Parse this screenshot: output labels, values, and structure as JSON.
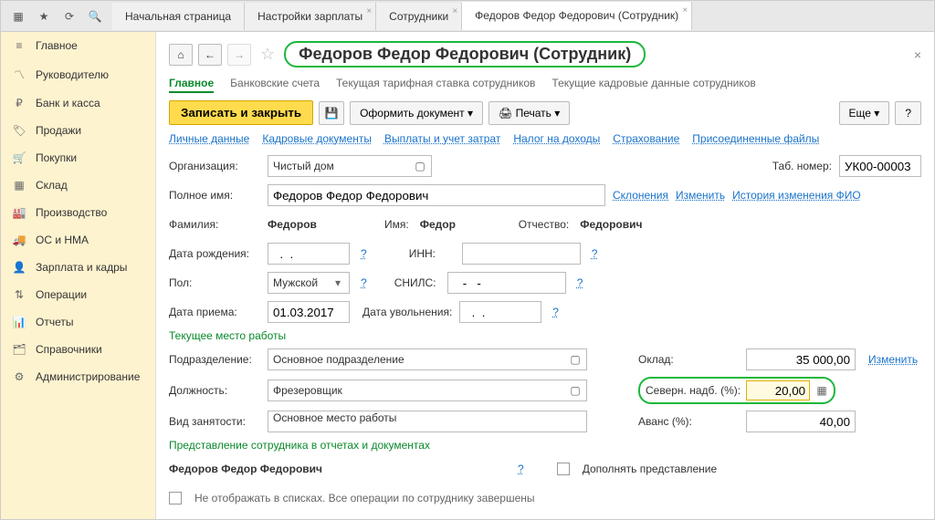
{
  "tabs": {
    "home": "Начальная страница",
    "payroll_settings": "Настройки зарплаты",
    "employees": "Сотрудники",
    "employee_card": "Федоров Федор Федорович (Сотрудник)"
  },
  "sidebar": {
    "items": [
      {
        "label": "Главное"
      },
      {
        "label": "Руководителю"
      },
      {
        "label": "Банк и касса"
      },
      {
        "label": "Продажи"
      },
      {
        "label": "Покупки"
      },
      {
        "label": "Склад"
      },
      {
        "label": "Производство"
      },
      {
        "label": "ОС и НМА"
      },
      {
        "label": "Зарплата и кадры"
      },
      {
        "label": "Операции"
      },
      {
        "label": "Отчеты"
      },
      {
        "label": "Справочники"
      },
      {
        "label": "Администрирование"
      }
    ]
  },
  "title": "Федоров Федор Федорович (Сотрудник)",
  "subtabs": {
    "main": "Главное",
    "bank": "Банковские счета",
    "rate": "Текущая тарифная ставка сотрудников",
    "hr": "Текущие кадровые данные сотрудников"
  },
  "toolbar": {
    "save_close": "Записать и закрыть",
    "doc": "Оформить документ",
    "print": "Печать",
    "more": "Еще",
    "help": "?"
  },
  "links": {
    "personal": "Личные данные",
    "hr_docs": "Кадровые документы",
    "payments": "Выплаты и учет затрат",
    "tax": "Налог на доходы",
    "insurance": "Страхование",
    "files": "Присоединенные файлы"
  },
  "labels": {
    "org": "Организация:",
    "tab_no": "Таб. номер:",
    "fullname": "Полное имя:",
    "declensions": "Склонения",
    "edit": "Изменить",
    "name_history": "История изменения ФИО",
    "lastname": "Фамилия:",
    "name": "Имя:",
    "patronymic": "Отчество:",
    "dob": "Дата рождения:",
    "inn": "ИНН:",
    "sex": "Пол:",
    "snils": "СНИЛС:",
    "hire_date": "Дата приема:",
    "fire_date": "Дата увольнения:",
    "workplace": "Текущее место работы",
    "department": "Подразделение:",
    "salary": "Оклад:",
    "position": "Должность:",
    "north": "Северн. надб. (%):",
    "employment": "Вид занятости:",
    "advance": "Аванс (%):",
    "representation": "Представление сотрудника в отчетах и документах",
    "supplement": "Дополнять представление",
    "hide": "Не отображать в списках. Все операции по сотруднику завершены",
    "q": "?"
  },
  "values": {
    "org": "Чистый дом",
    "tab_no": "УК00-00003",
    "fullname": "Федоров Федор Федорович",
    "lastname": "Федоров",
    "name": "Федор",
    "patronymic": "Федорович",
    "dob": "  .  .    ",
    "inn": "",
    "sex": "Мужской",
    "snils": "   -   -       ",
    "hire_date": "01.03.2017",
    "fire_date": "  .  .    ",
    "department": "Основное подразделение",
    "salary": "35 000,00",
    "position": "Фрезеровщик",
    "north": "20,00",
    "employment": "Основное место работы",
    "advance": "40,00",
    "repr_name": "Федоров Федор Федорович"
  }
}
